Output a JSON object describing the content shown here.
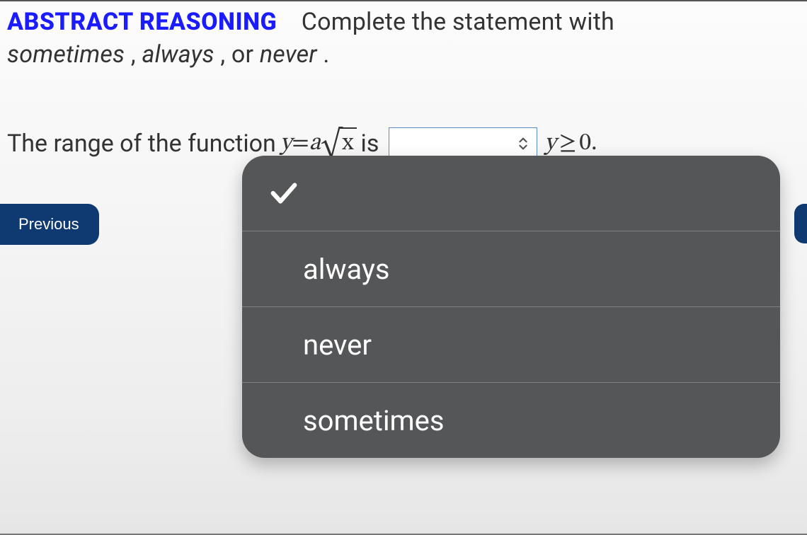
{
  "heading": {
    "label": "ABSTRACT REASONING",
    "rest_before_italics": "Complete the statement with ",
    "word1": "sometimes",
    "sep1": ", ",
    "word2": "always",
    "sep2": ", or ",
    "word3": "never",
    "tail": "."
  },
  "question": {
    "lead": "The range of the function ",
    "eq_var": "y",
    "eq_eq": " = ",
    "eq_coef": "a",
    "eq_rad_inner": "x",
    "after_eq": " is",
    "tail_var": "y",
    "tail_ge": "≥",
    "tail_zero": "0",
    "tail_period": " ."
  },
  "select": {
    "placeholder": "",
    "options": [
      {
        "label": "",
        "selected": true
      },
      {
        "label": "always",
        "selected": false
      },
      {
        "label": "never",
        "selected": false
      },
      {
        "label": "sometimes",
        "selected": false
      }
    ]
  },
  "nav": {
    "prev": "Previous"
  }
}
